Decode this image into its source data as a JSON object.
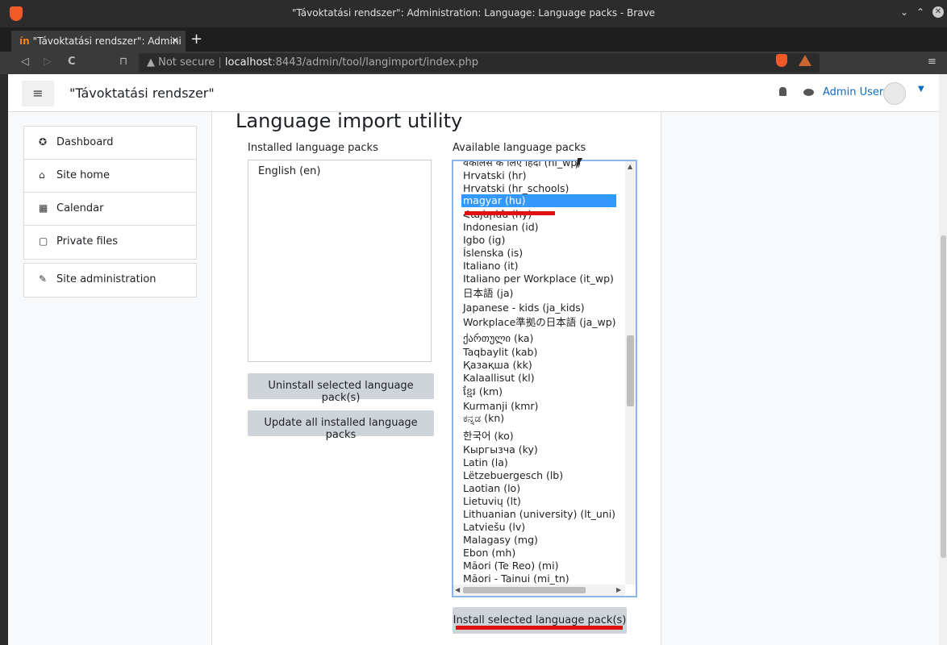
{
  "window": {
    "title": "\"Távoktatási rendszer\": Administration: Language: Language packs - Brave"
  },
  "tab": {
    "title": "\"Távoktatási rendszer\": Admini",
    "close": "×",
    "favicon": "ín",
    "new_tab": "+"
  },
  "browser": {
    "back": "◁",
    "forward": "▷",
    "reload": "C",
    "bookmark": "⊓",
    "security": "▲ Not secure",
    "url_host": "localhost",
    "url_rest": ":8443/admin/tool/langimport/index.php",
    "menu": "≡"
  },
  "navbar": {
    "menu_icon": "≡",
    "site_name": "\"Távoktatási rendszer\"",
    "user_name": "Admin User",
    "caret": "▼"
  },
  "sidebar": {
    "items": [
      {
        "label": "Dashboard",
        "icon": "✪"
      },
      {
        "label": "Site home",
        "icon": "⌂"
      },
      {
        "label": "Calendar",
        "icon": "▦"
      },
      {
        "label": "Private files",
        "icon": "▢"
      }
    ],
    "admin": {
      "label": "Site administration",
      "icon": "✎"
    }
  },
  "main": {
    "heading": "Language import utility",
    "installed_label": "Installed language packs",
    "available_label": "Available language packs",
    "installed": [
      "English (en)"
    ],
    "uninstall_button": "Uninstall selected language pack(s)",
    "update_button": "Update all installed language packs",
    "install_button": "Install selected language pack(s)",
    "available": [
      "वकलिस के लिए हिंदी (hi_wp)",
      "Hrvatski (hr)",
      "Hrvatski (hr_schools)",
      "magyar (hu)",
      "Հայերեն (hy)",
      "Indonesian (id)",
      "Igbo (ig)",
      "Íslenska (is)",
      "Italiano (it)",
      "Italiano per Workplace (it_wp)",
      "日本語 (ja)",
      "Japanese - kids (ja_kids)",
      "Workplace準拠の日本語 (ja_wp)",
      "ქართული (ka)",
      "Taqbaylit (kab)",
      "Қазақша (kk)",
      "Kalaallisut (kl)",
      "ខ្មែរ (km)",
      "Kurmanji (kmr)",
      "ಕನ್ನಡ (kn)",
      "한국어 (ko)",
      "Кыргызча (ky)",
      "Latin (la)",
      "Lëtzebuergesch (lb)",
      "Laotian (lo)",
      "Lietuvių (lt)",
      "Lithuanian (university) (lt_uni)",
      "Latviešu (lv)",
      "Malagasy (mg)",
      "Ebon (mh)",
      "Māori (Te Reo) (mi)",
      "Māori - Tainui (mi_tn)"
    ],
    "selected_index": 3
  },
  "colors": {
    "selection": "#3399ff",
    "annotation": "#e01010",
    "link": "#0f6cbf"
  }
}
